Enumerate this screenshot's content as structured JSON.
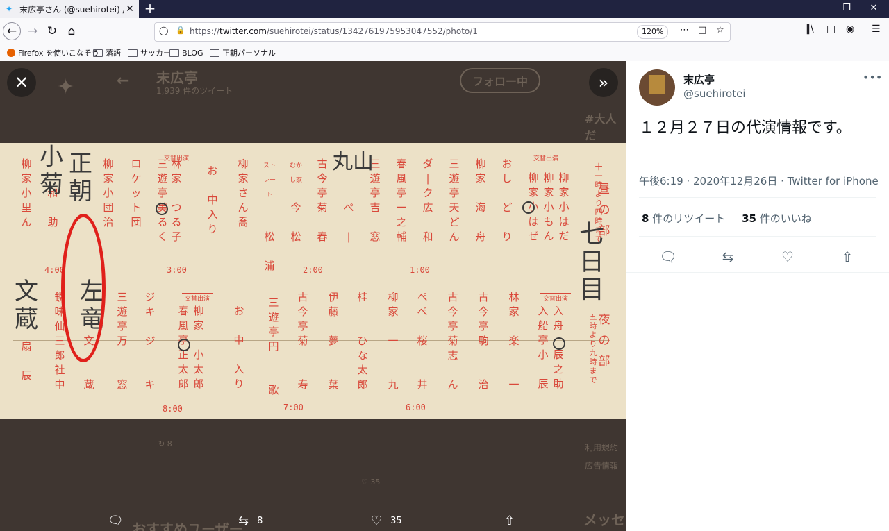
{
  "browser": {
    "tab_title": "末広亭さん (@suehirotei) / Twitt",
    "tab_close": "✕",
    "new_tab": "+",
    "url_prefix": "https://",
    "url_domain": "twitter.com",
    "url_path": "/suehirotei/status/1342761975953047552/photo/1",
    "zoom": "120%",
    "bookmarks": [
      {
        "label": "Firefox を使いこなそう",
        "icon": "firefox-icon"
      },
      {
        "label": "落語",
        "icon": "folder-icon"
      },
      {
        "label": "サッカー",
        "icon": "folder-icon"
      },
      {
        "label": "BLOG",
        "icon": "folder-icon"
      },
      {
        "label": "正朝パーソナル",
        "icon": "folder-icon"
      }
    ]
  },
  "viewer": {
    "bg_name": "末広亭",
    "bg_tweets": "1,939 件のツイート",
    "bg_follow": "フォロー中",
    "bg_tag": "#大人だ",
    "bg_recommend": "おすすめユーザー",
    "bg_message": "メッセ",
    "bg_terms": "利用規約",
    "bg_ad": "広告情報",
    "bg_rt": "8",
    "bg_like": "35",
    "close_glyph": "✕",
    "expand_glyph": "»",
    "retweet_count": "8",
    "like_count": "35"
  },
  "program": {
    "times": [
      "4:00",
      "3:00",
      "2:00",
      "1:00",
      "8:00",
      "7:00",
      "6:00"
    ],
    "badge": "交替出演",
    "day_label": "昼の部",
    "day_hours": "十一時より四時まで",
    "night_label": "夜の部",
    "night_hours": "五時より九時まで",
    "handwritten": {
      "left_top": "小菊",
      "circled": "正朝",
      "maruyama": "丸山",
      "nanokame": "七日目",
      "bunzo": "文蔵",
      "sa": "左竜"
    },
    "top_columns": [
      "柳家小里ん",
      "柳家小団治",
      "ロケット団",
      "林家つる子",
      "お中入り",
      "柳家さん喬",
      "松浦",
      "古今亭菊松",
      "林家ぺー",
      "三遊亭吉窓",
      "春風亭一之輔",
      "ダーク広和",
      "三遊亭天どん",
      "柳家海舟",
      "おしどり",
      "柳家小はぜ",
      "柳家小んだ",
      "柳家小はも"
    ],
    "bottom_columns": [
      "鏡味仙三郎社中",
      "三遊亭万窓",
      "ジキジキ",
      "春風亭正太郎",
      "柳家小太郎",
      "お中入り",
      "三遊亭円歌",
      "古今亭菊寿",
      "伊藤夢葉",
      "桂ひな太郎",
      "柳家一九",
      "ぺぺ桜井",
      "古今亭菊志ん",
      "古今亭駒治",
      "林家楽一",
      "入船亭小辰",
      "入船亭辰之助"
    ]
  },
  "tweet": {
    "display_name": "末広亭",
    "handle": "@suehirotei",
    "text": "１２月２７日の代演情報です。",
    "time": "午後6:19 · 2020年12月26日 · Twitter for iPhone",
    "retweets_num": "8",
    "retweets_label": " 件のリツイート",
    "likes_num": "35",
    "likes_label": " 件のいいね"
  }
}
